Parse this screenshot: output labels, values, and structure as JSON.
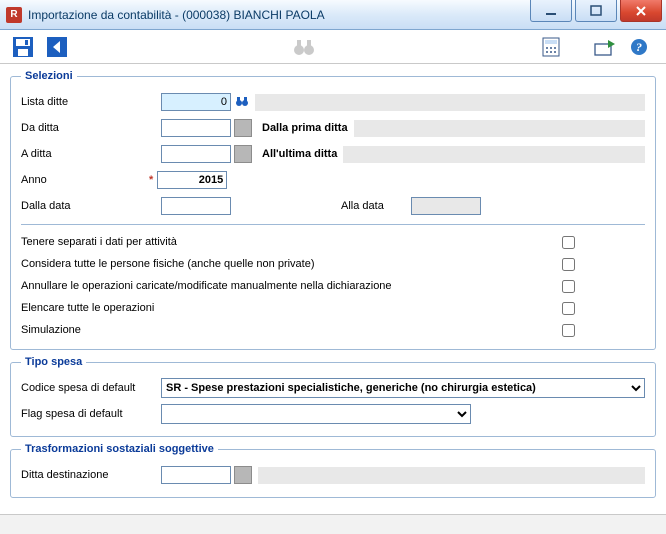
{
  "window": {
    "title": "Importazione da contabilità  -  (000038) BIANCHI PAOLA",
    "app_icon_letter": "R"
  },
  "selezioni": {
    "legend": "Selezioni",
    "lista_ditte_label": "Lista ditte",
    "lista_ditte_value": "0",
    "da_ditta_label": "Da ditta",
    "da_ditta_value": "",
    "da_ditta_suffix": "Dalla prima ditta",
    "a_ditta_label": "A ditta",
    "a_ditta_value": "",
    "a_ditta_suffix": "All'ultima ditta",
    "anno_label": "Anno",
    "anno_value": "2015",
    "dalla_data_label": "Dalla data",
    "dalla_data_value": "",
    "alla_data_label": "Alla data",
    "alla_data_value": "",
    "checks": [
      {
        "label": "Tenere separati i dati per attività",
        "checked": false
      },
      {
        "label": "Considera tutte le persone fisiche (anche quelle non private)",
        "checked": false
      },
      {
        "label": "Annullare le operazioni caricate/modificate manualmente nella dichiarazione",
        "checked": false
      },
      {
        "label": "Elencare tutte le operazioni",
        "checked": false
      },
      {
        "label": "Simulazione",
        "checked": false
      }
    ]
  },
  "tipo_spesa": {
    "legend": "Tipo spesa",
    "codice_label": "Codice spesa di default",
    "codice_options": [
      "SR - Spese prestazioni specialistiche, generiche (no chirurgia estetica)"
    ],
    "codice_selected": "SR - Spese prestazioni specialistiche, generiche (no chirurgia estetica)",
    "flag_label": "Flag spesa di default",
    "flag_options": [
      ""
    ],
    "flag_selected": ""
  },
  "trasformazioni": {
    "legend": "Trasformazioni sostaziali soggettive",
    "ditta_dest_label": "Ditta destinazione",
    "ditta_dest_value": ""
  }
}
